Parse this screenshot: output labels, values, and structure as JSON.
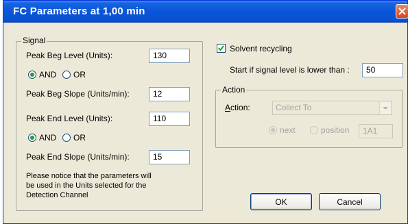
{
  "window": {
    "title": "FC Parameters at 1,00 min"
  },
  "signal": {
    "legend": "Signal",
    "peak_beg_level_label": "Peak Beg Level (Units):",
    "peak_beg_level_value": "130",
    "and_label_1": "AND",
    "or_label_1": "OR",
    "peak_beg_slope_label": "Peak Beg Slope (Units/min):",
    "peak_beg_slope_value": "12",
    "peak_end_level_label": "Peak End Level (Units):",
    "peak_end_level_value": "110",
    "and_label_2": "AND",
    "or_label_2": "OR",
    "peak_end_slope_label": "Peak End Slope (Units/min):",
    "peak_end_slope_value": "15",
    "notice": [
      "Please notice that the parameters will",
      "be used in the Units selected for the",
      "Detection Channel"
    ]
  },
  "recycling": {
    "checkbox_label": "Solvent recycling",
    "checked": true,
    "start_label": "Start if signal level is lower than :",
    "start_value": "50"
  },
  "action": {
    "legend": "Action",
    "action_label": "Action:",
    "action_selected": "Collect To",
    "next_label": "next",
    "position_label": "position",
    "position_value": "1A1"
  },
  "buttons": {
    "ok": "OK",
    "cancel": "Cancel"
  },
  "colors": {
    "titlebar": "#0a55d8",
    "dialog_bg": "#ece9d8",
    "close": "#d9431c"
  }
}
